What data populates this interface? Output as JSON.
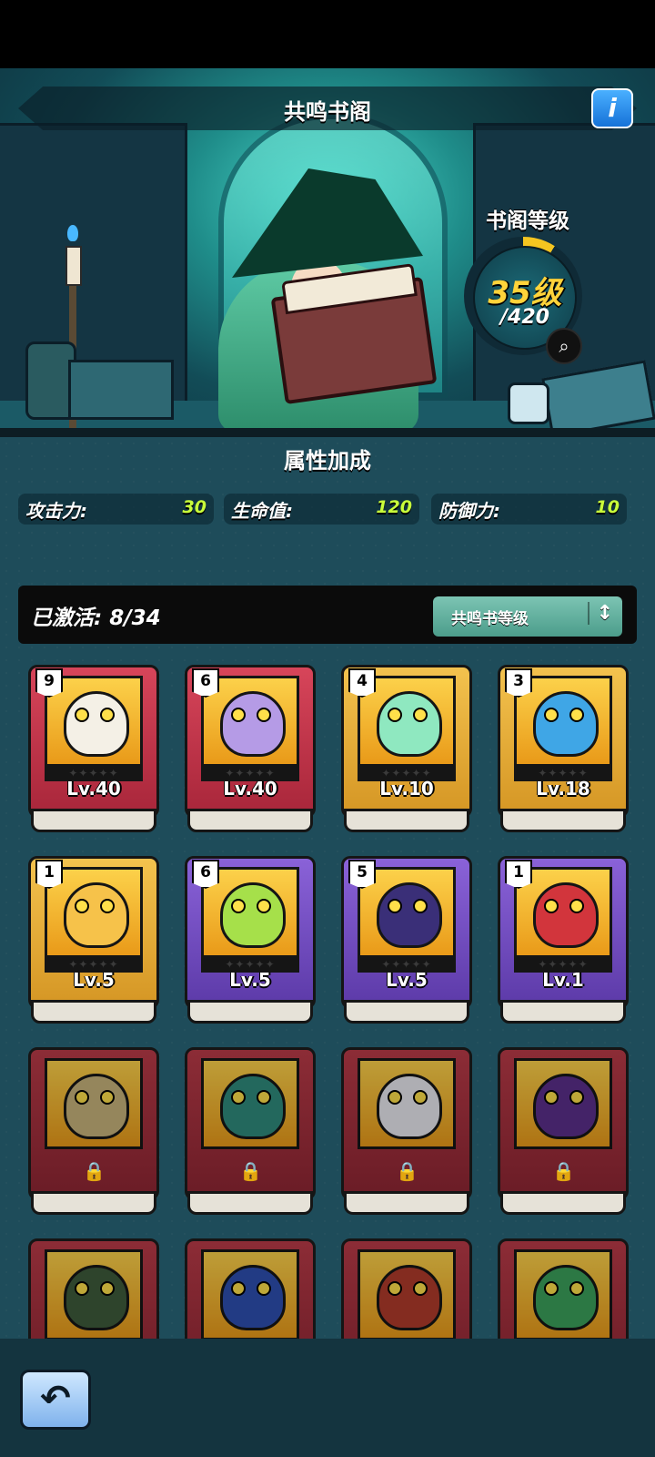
{
  "header": {
    "title": "共鸣书阁",
    "info_label": "i"
  },
  "library_level": {
    "label": "书阁等级",
    "value": "35级",
    "max": "/420"
  },
  "attributes": {
    "title": "属性加成",
    "stats": [
      {
        "label": "攻击力:",
        "value": "30"
      },
      {
        "label": "生命值:",
        "value": "120"
      },
      {
        "label": "防御力:",
        "value": "10"
      }
    ]
  },
  "activation": {
    "text": "已激活: 8/34",
    "sort_label": "共鸣书等级",
    "sort_icon": "↕"
  },
  "cards": [
    {
      "badge": "9",
      "level": "Lv.40",
      "rarity": "red",
      "locked": false,
      "monster_color": "#f4f0e6",
      "stars": "✦✦✦✦✦"
    },
    {
      "badge": "6",
      "level": "Lv.40",
      "rarity": "red",
      "locked": false,
      "monster_color": "#b59be6",
      "stars": "✦✦✦✦✦"
    },
    {
      "badge": "4",
      "level": "Lv.10",
      "rarity": "gold",
      "locked": false,
      "monster_color": "#8fe8c0",
      "stars": "✦✦✦✦✦"
    },
    {
      "badge": "3",
      "level": "Lv.18",
      "rarity": "gold",
      "locked": false,
      "monster_color": "#3fa6e6",
      "stars": "✦✦✦✦✦"
    },
    {
      "badge": "1",
      "level": "Lv.5",
      "rarity": "gold",
      "locked": false,
      "monster_color": "#f6c24a",
      "stars": "✦✦✦✦✦"
    },
    {
      "badge": "6",
      "level": "Lv.5",
      "rarity": "purple",
      "locked": false,
      "monster_color": "#a6e04a",
      "stars": "✦✦✦✦✦"
    },
    {
      "badge": "5",
      "level": "Lv.5",
      "rarity": "purple",
      "locked": false,
      "monster_color": "#3a2f78",
      "stars": "✦✦✦✦✦"
    },
    {
      "badge": "1",
      "level": "Lv.1",
      "rarity": "purple",
      "locked": false,
      "monster_color": "#d2353c",
      "stars": "✦✦✦✦✦"
    },
    {
      "badge": "",
      "level": "",
      "rarity": "darkred",
      "locked": true,
      "monster_color": "#c7b27a",
      "stars": ""
    },
    {
      "badge": "",
      "level": "",
      "rarity": "darkred",
      "locked": true,
      "monster_color": "#2f8a7c",
      "stars": ""
    },
    {
      "badge": "",
      "level": "",
      "rarity": "darkred",
      "locked": true,
      "monster_color": "#e8e8ee",
      "stars": ""
    },
    {
      "badge": "",
      "level": "",
      "rarity": "darkred",
      "locked": true,
      "monster_color": "#5a2f8a",
      "stars": ""
    },
    {
      "badge": "",
      "level": "",
      "rarity": "darkred",
      "locked": true,
      "monster_color": "#3d5a3a",
      "stars": ""
    },
    {
      "badge": "",
      "level": "",
      "rarity": "darkred",
      "locked": true,
      "monster_color": "#2d4fb0",
      "stars": ""
    },
    {
      "badge": "",
      "level": "",
      "rarity": "darkred",
      "locked": true,
      "monster_color": "#b03a2a",
      "stars": ""
    },
    {
      "badge": "",
      "level": "",
      "rarity": "darkred",
      "locked": true,
      "monster_color": "#3aa05a",
      "stars": ""
    }
  ],
  "footer": {
    "back_icon": "back-arrow-icon"
  }
}
